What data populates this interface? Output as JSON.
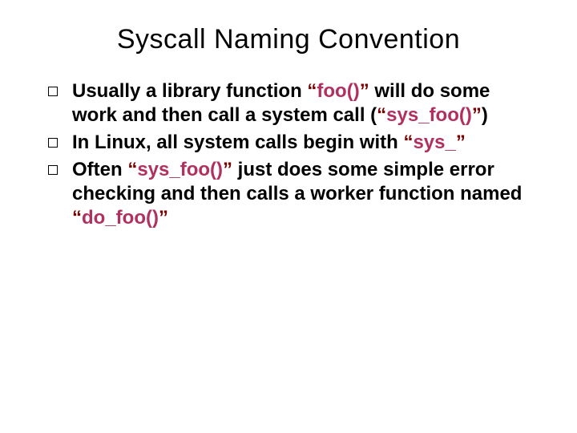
{
  "title": "Syscall Naming Convention",
  "bullets": [
    {
      "pre1": "Usually a library function ",
      "q1a": "“",
      "code1": "foo()",
      "q1b": "”",
      "mid1": " will do some work and then call a system call (",
      "q2a": "“",
      "code2": "sys_foo()",
      "q2b": "”",
      "post1": ")"
    },
    {
      "pre1": "In Linux, all system calls begin with ",
      "q1a": "“",
      "code1": "sys_",
      "q1b": "”",
      "post1": ""
    },
    {
      "pre1": "Often ",
      "q1a": "“",
      "code1": "sys_foo()",
      "q1b": "”",
      "mid1": " just does some simple error checking and then calls a worker function named ",
      "q2a": "“",
      "code2": "do_foo()",
      "q2b": "”",
      "post1": ""
    }
  ]
}
